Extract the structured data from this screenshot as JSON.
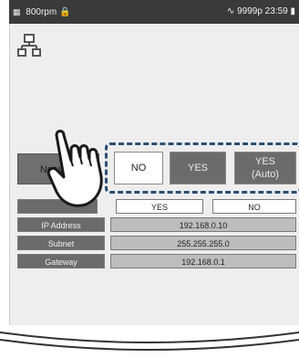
{
  "status_bar": {
    "left_text": "800rpm",
    "right_text": "9999p",
    "time": "23:59"
  },
  "network_button": {
    "label": "Network"
  },
  "options": {
    "no": "NO",
    "yes": "YES",
    "yes_auto_line1": "YES",
    "yes_auto_line2": "(Auto)"
  },
  "table": {
    "header": {
      "col2": "YES",
      "col3": "NO"
    },
    "rows": [
      {
        "label": "IP Address",
        "value": "192.168.0.10"
      },
      {
        "label": "Subnet",
        "value": "255.255.255.0"
      },
      {
        "label": "Gateway",
        "value": "192.168.0.1"
      }
    ]
  }
}
